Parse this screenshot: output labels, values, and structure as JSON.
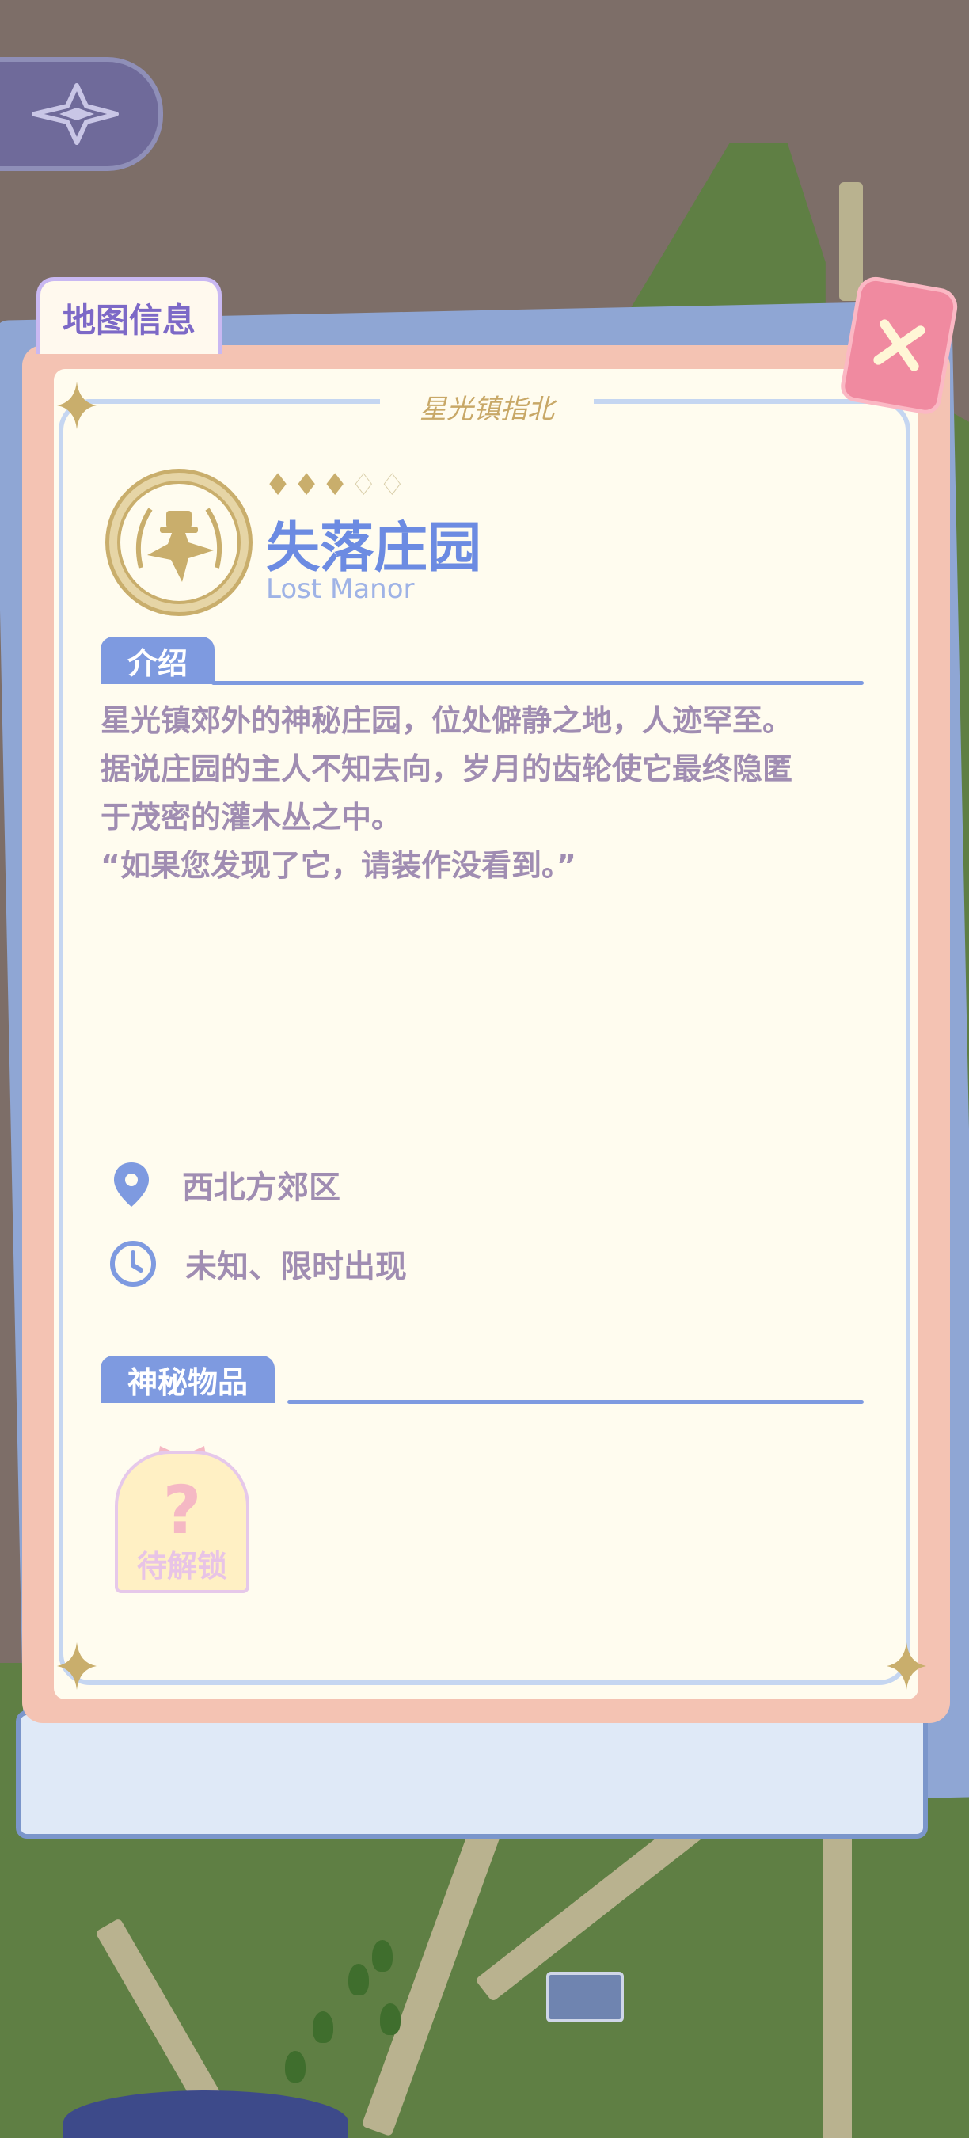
{
  "map_tab": {
    "label": "地图信息"
  },
  "header": {
    "signature": "星光镇指北"
  },
  "location": {
    "rating": {
      "filled": 3,
      "total": 5
    },
    "name_cn": "失落庄园",
    "name_en": "Lost Manor"
  },
  "intro": {
    "title": "介绍",
    "lines": [
      "星光镇郊外的神秘庄园，位处僻静之地，人迹罕至。",
      "据说庄园的主人不知去向，岁月的齿轮使它最终隐匿",
      "于茂密的灌木丛之中。",
      "“如果您发现了它，请装作没看到。”"
    ]
  },
  "info": {
    "region": "西北方郊区",
    "time": "未知、限时出现"
  },
  "items": {
    "title": "神秘物品",
    "entries": [
      {
        "symbol": "?",
        "label": "待解锁"
      }
    ]
  },
  "icons": {
    "back": "compass-star-icon",
    "close": "close-x-icon",
    "location": "map-pin-icon",
    "time": "clock-icon",
    "emblem": "manor-emblem-icon"
  },
  "colors": {
    "accent_blue": "#7e9ae0",
    "title_blue": "#6c8be2",
    "text_purple": "#a08db2",
    "panel_pink": "#f4c3b3",
    "gold": "#c9ae6c",
    "close_pink": "#f08aa0"
  }
}
